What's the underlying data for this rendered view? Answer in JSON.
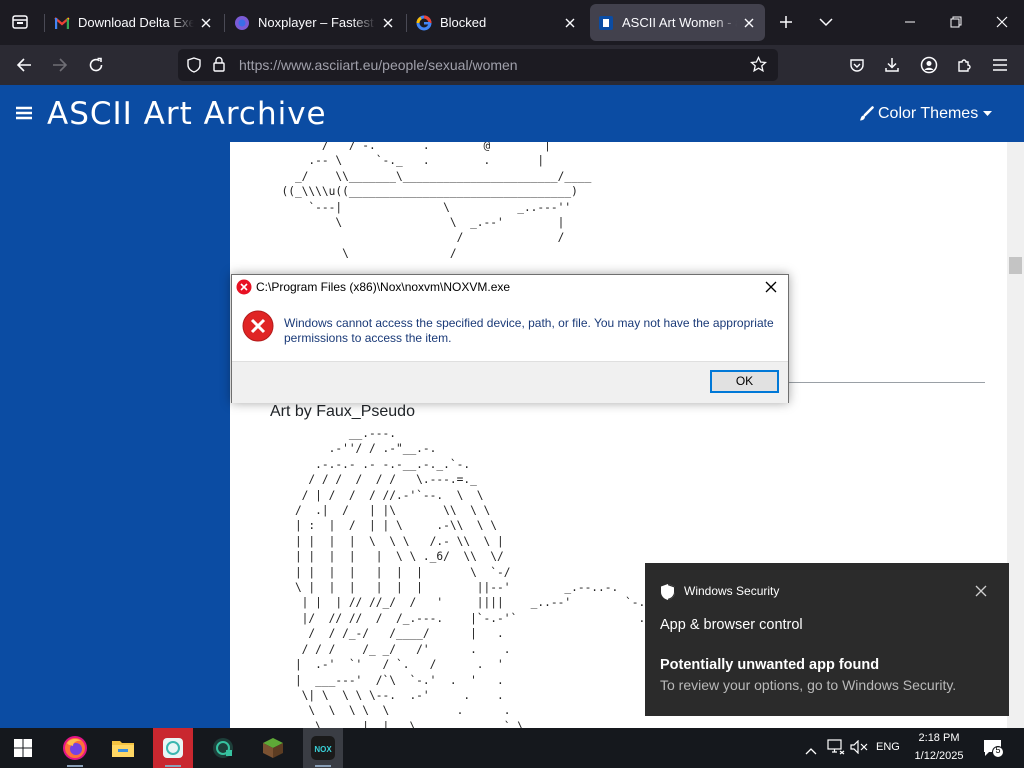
{
  "browser": {
    "tabs": [
      {
        "title": "Download Delta Executor",
        "icon": "gmail-icon",
        "active": false
      },
      {
        "title": "Noxplayer – Fastest and",
        "icon": "noxplayer-icon",
        "active": false
      },
      {
        "title": "Blocked",
        "icon": "google-icon",
        "active": false
      },
      {
        "title": "ASCII Art Women - ascii art",
        "icon": "asciiart-icon",
        "active": true
      }
    ],
    "url": "https://www.asciiart.eu/people/sexual/women"
  },
  "site": {
    "title": "ASCII Art Archive",
    "color_themes_label": "Color Themes",
    "art_caption": "Art by Faux_Pseudo",
    "art_top": "        /   /`-.       .        @        |\n      .-- \\     `-._   .        .       |\n    _/    \\\\_______\\_______________________/____\n  ((_\\\\\\\\u((_________________________________)\n      `---|               \\          _..---''\n          \\                \\  _.--'        |\n                            /              /\n           \\               /",
    "art_bottom": "            __.---.\n         .-''/ / .-\"__.-.\n       .-.-.- .- -.-__.-._.`-.\n      / / /  /  / /   \\.---.=._\n     / | /  /  / //.-'`--.  \\  \\\n    /  .|  /   | |\\       \\\\  \\ \\\n    | :  |  /  | | \\     .-\\\\  \\ \\\n    | |  |  |  \\  \\ \\   /.- \\\\  \\ |\n    | |  |  |   |  \\ \\ ._6/  \\\\  \\/\n    | |  |  |   |  |  |       \\  `-/\n    \\ |  |  |   |  |  |        ||--'        _.--..-.\n     | |  | // //_/  /   '     ||||    _..--'        `-.\n     |/  // //  /  /_.---.    |`-.-'`                  .\n      /  / /_-/   /____/      |   .\n     / / /    /_ _/   /'      .    .\n    |  .-'  `'   / `.   /      .  '\n    |  ___---'  /`\\  `-.'  .  '   .\n     \\| \\  \\ \\ \\--.  .-'     .    .\n      \\  \\  \\ \\  \\          .      .\n       \\ .__  |  |   \\  .   .      `.\\\n        `.  |||   \\         .       .:."
  },
  "dialog": {
    "title": "C:\\Program Files (x86)\\Nox\\noxvm\\NOXVM.exe",
    "message": "Windows cannot access the specified device, path, or file. You may not have the appropriate permissions to access the item.",
    "ok_label": "OK"
  },
  "toast": {
    "app": "Windows Security",
    "heading": "App & browser control",
    "title": "Potentially unwanted app found",
    "body": "To review your options, go to Windows Security."
  },
  "taskbar": {
    "apps": [
      "firefox-icon",
      "file-explorer-icon",
      "app-icon",
      "globe-app-icon",
      "minecraft-icon",
      "nox-icon"
    ],
    "language": "ENG",
    "time": "2:18 PM",
    "date": "1/12/2025",
    "notification_count": "5"
  }
}
